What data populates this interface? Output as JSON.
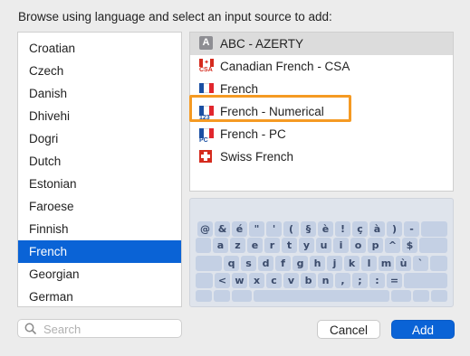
{
  "prompt": "Browse using language and select an input source to add:",
  "languages": [
    "Croatian",
    "Czech",
    "Danish",
    "Dhivehi",
    "Dogri",
    "Dutch",
    "Estonian",
    "Faroese",
    "Finnish",
    "French",
    "Georgian",
    "German"
  ],
  "selected_language": "French",
  "sources": [
    {
      "label": "ABC - AZERTY",
      "icon": "abc-icon"
    },
    {
      "label": "Canadian French - CSA",
      "icon": "canada-flag-icon",
      "badge": "CSA"
    },
    {
      "label": "French",
      "icon": "france-flag-icon"
    },
    {
      "label": "French - Numerical",
      "icon": "france-flag-icon",
      "badge": "123"
    },
    {
      "label": "French - PC",
      "icon": "france-flag-icon",
      "badge": "PC"
    },
    {
      "label": "Swiss French",
      "icon": "swiss-flag-icon"
    }
  ],
  "selected_source": "ABC - AZERTY",
  "icon_letters": {
    "abc": "A"
  },
  "keyboard": {
    "rows": [
      [
        "@",
        "&",
        "é",
        "\"",
        "'",
        "(",
        "§",
        "è",
        "!",
        "ç",
        "à",
        ")",
        "-"
      ],
      [
        "a",
        "z",
        "e",
        "r",
        "t",
        "y",
        "u",
        "i",
        "o",
        "p",
        "^",
        "$"
      ],
      [
        "q",
        "s",
        "d",
        "f",
        "g",
        "h",
        "j",
        "k",
        "l",
        "m",
        "ù",
        "`"
      ],
      [
        "<",
        "w",
        "x",
        "c",
        "v",
        "b",
        "n",
        ",",
        ";",
        ":",
        "="
      ]
    ]
  },
  "search": {
    "placeholder": "Search",
    "value": ""
  },
  "buttons": {
    "cancel": "Cancel",
    "add": "Add"
  },
  "colors": {
    "accent": "#0a63d6",
    "highlight": "#f59a23",
    "france_blue": "#1a4fa3",
    "france_red": "#e1262d",
    "canada_red": "#d52b1e",
    "swiss_red": "#d52b1e"
  }
}
